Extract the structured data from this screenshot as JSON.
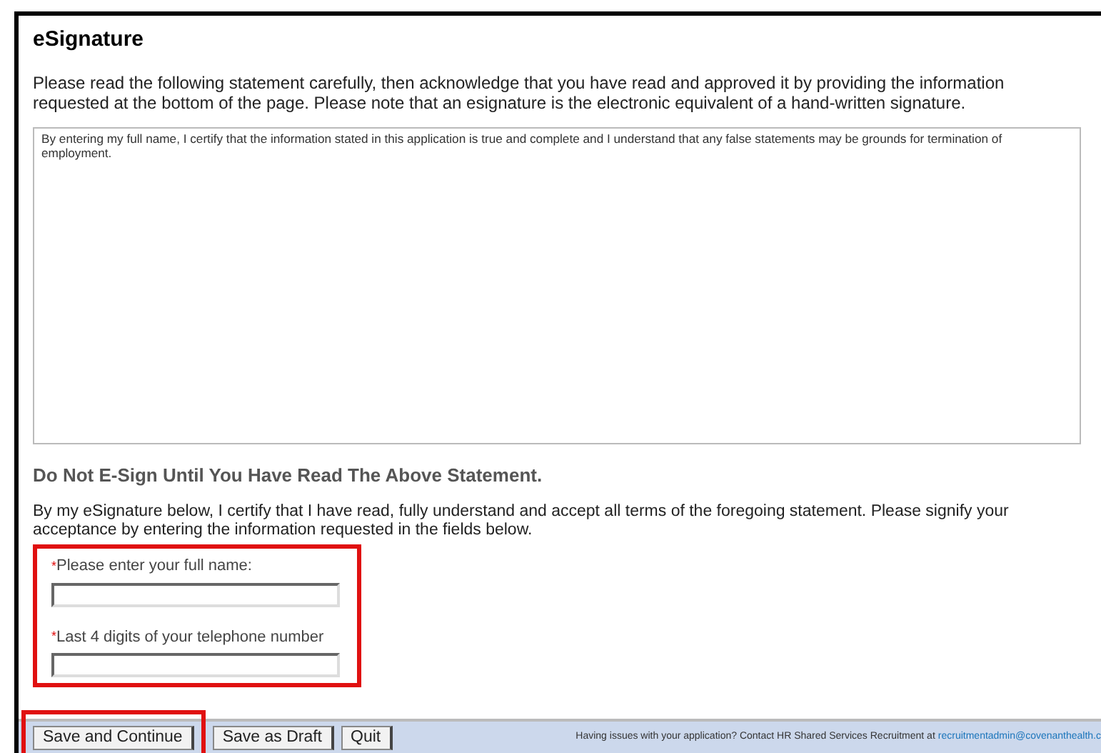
{
  "title": "eSignature",
  "intro": "Please read the following statement carefully, then acknowledge that you have read and approved it by providing the information requested at the bottom of the page. Please note that an esignature is the electronic equivalent of a hand-written signature.",
  "statement": "By entering my full name, I certify that the information stated in this application is true and complete and I understand that any false statements may be grounds for termination of employment.",
  "warning": "Do Not E-Sign Until You Have Read The Above Statement.",
  "certify": "By my eSignature below, I certify that I have read, fully understand and accept all terms of the foregoing statement. Please signify your acceptance by entering the information requested in the fields below.",
  "fields_highlighted": true,
  "fields": [
    {
      "required_mark": "*",
      "label": "Please enter your full name:"
    },
    {
      "required_mark": "*",
      "label": "Last 4 digits of your telephone number"
    }
  ],
  "buttons": [
    {
      "label": "Save and Continue",
      "highlighted": true
    },
    {
      "label": "Save as Draft",
      "highlighted": false
    },
    {
      "label": "Quit",
      "highlighted": false
    }
  ],
  "footer": {
    "text": "Having issues with your application? Contact HR Shared Services Recruitment at",
    "link": "recruitmentadmin@covenanthealth.c"
  }
}
